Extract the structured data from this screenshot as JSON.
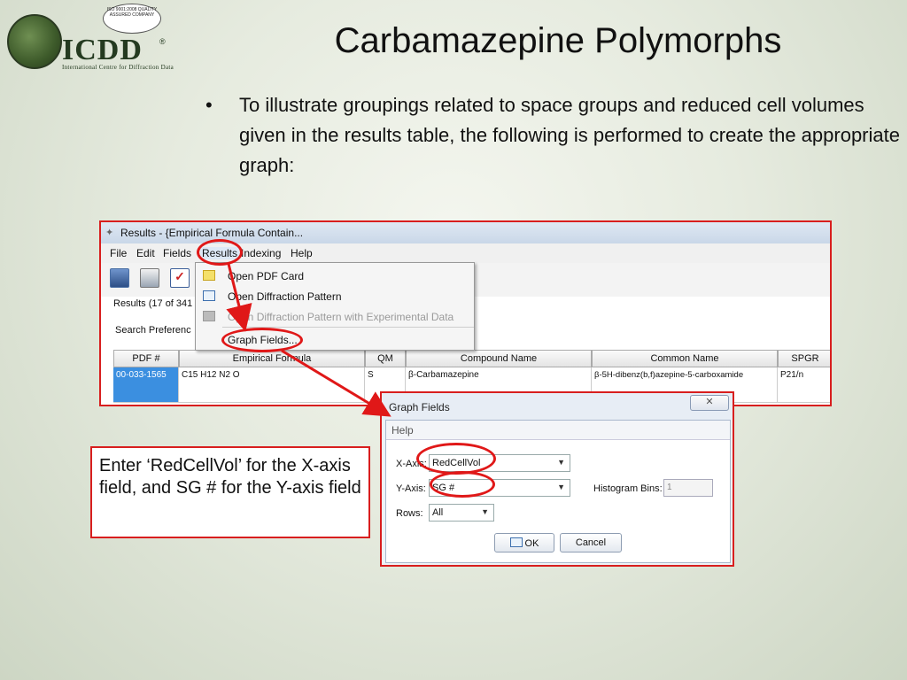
{
  "logo": {
    "brand": "ICDD",
    "registered": "®",
    "subtitle": "International Centre for Diffraction Data",
    "iso_badge": "ISO 9001:2008 QUALITY ASSURED COMPANY"
  },
  "slide": {
    "title": "Carbamazepine Polymorphs",
    "bullet_symbol": "•",
    "bullet_text": "To illustrate groupings related to space groups and reduced cell volumes given in the results table, the following is performed to create the appropriate graph:"
  },
  "results_window": {
    "title": "Results - {Empirical Formula Contain...",
    "menus": [
      "File",
      "Edit",
      "Fields",
      "Results",
      "Indexing",
      "Help"
    ],
    "status": "Results (17 of 341",
    "search_pref": "Search Preferenc",
    "columns": [
      "PDF #",
      "Empirical Formula",
      "QM",
      "Compound Name",
      "Common Name",
      "SPGR"
    ],
    "row": {
      "pdf": "00-033-1565",
      "formula": "C15 H12 N2 O",
      "qm": "S",
      "compound": "β-Carbamazepine",
      "common": "β-5H-dibenz(b,f)azepine-5-carboxamide",
      "spgr": "P21/n"
    }
  },
  "results_menu": {
    "items": [
      "Open PDF Card",
      "Open Diffraction Pattern",
      "Open Diffraction Pattern with Experimental Data",
      "Graph Fields..."
    ]
  },
  "graph_dialog": {
    "title": "Graph Fields",
    "close_glyph": "✕",
    "menu": "Help",
    "x_axis_label": "X-Axis:",
    "x_axis_value": "RedCellVol",
    "y_axis_label": "Y-Axis:",
    "y_axis_value": "SG #",
    "rows_label": "Rows:",
    "rows_value": "All",
    "bins_label": "Histogram Bins:",
    "bins_value": "1",
    "ok": "OK",
    "cancel": "Cancel"
  },
  "callout": {
    "text": "Enter ‘RedCellVol’ for the X-axis field, and SG # for the Y-axis field"
  },
  "colors": {
    "highlight": "#e01818",
    "selected_cell": "#3b8fe0"
  }
}
